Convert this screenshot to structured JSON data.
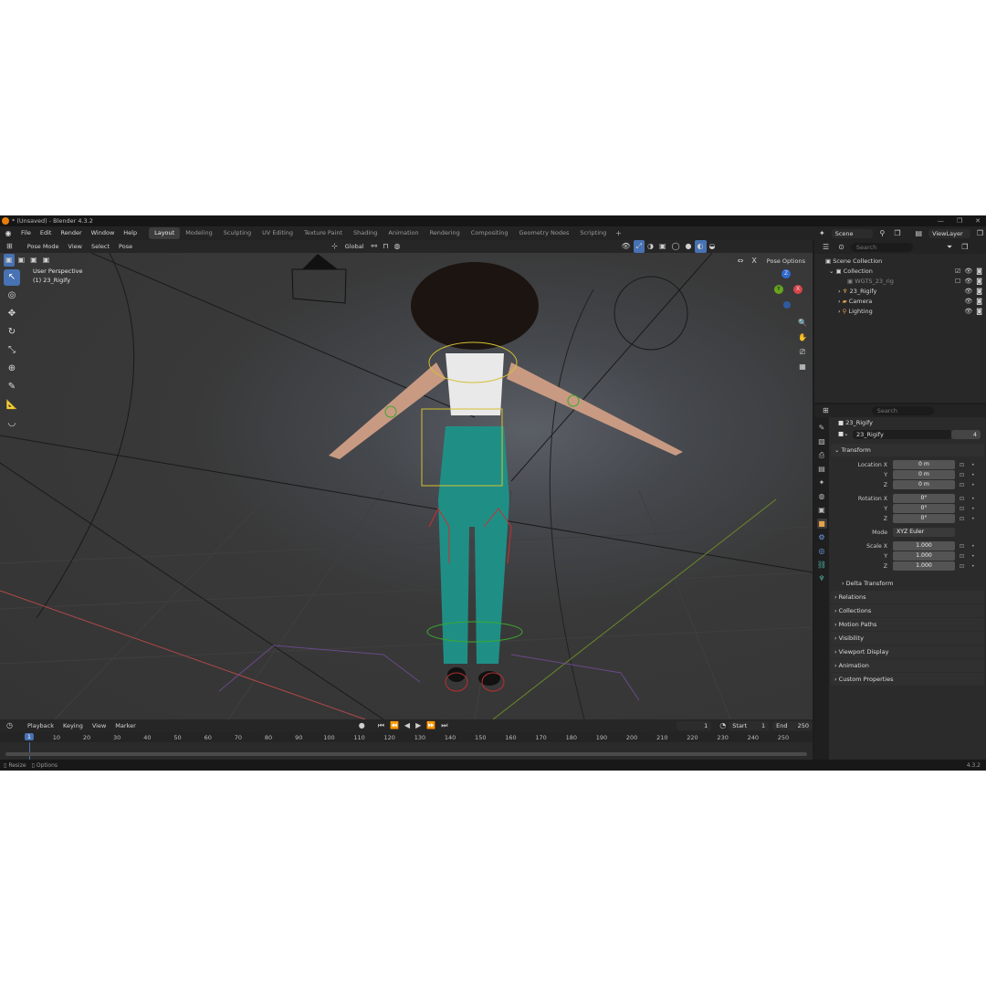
{
  "window": {
    "title": "* (Unsaved) - Blender 4.3.2",
    "controls": [
      "—",
      "❐",
      "✕"
    ]
  },
  "menus": [
    "File",
    "Edit",
    "Render",
    "Window",
    "Help"
  ],
  "workspaces": [
    {
      "label": "Layout",
      "active": true
    },
    {
      "label": "Modeling"
    },
    {
      "label": "Sculpting"
    },
    {
      "label": "UV Editing"
    },
    {
      "label": "Texture Paint"
    },
    {
      "label": "Shading"
    },
    {
      "label": "Animation"
    },
    {
      "label": "Rendering"
    },
    {
      "label": "Compositing"
    },
    {
      "label": "Geometry Nodes"
    },
    {
      "label": "Scripting"
    }
  ],
  "scene": {
    "name": "Scene",
    "view_layer": "ViewLayer"
  },
  "viewport_header": {
    "mode": "Pose Mode",
    "menus": [
      "View",
      "Select",
      "Pose"
    ],
    "orientation": "Global",
    "pose_options": "Pose Options"
  },
  "viewport": {
    "perspective_label": "User Perspective",
    "object_label": "(1) 23_Rigify",
    "axes": {
      "x": "X",
      "y": "Y",
      "z": "Z"
    }
  },
  "timeline": {
    "menus": [
      "Playback",
      "Keying",
      "View",
      "Marker"
    ],
    "current_frame": "1",
    "start_label": "Start",
    "start": "1",
    "end_label": "End",
    "end": "250",
    "ticks": [
      "1",
      "10",
      "20",
      "30",
      "40",
      "50",
      "60",
      "70",
      "80",
      "90",
      "100",
      "110",
      "120",
      "130",
      "140",
      "150",
      "160",
      "170",
      "180",
      "190",
      "200",
      "210",
      "220",
      "230",
      "240",
      "250"
    ]
  },
  "status": {
    "left1": "Resize",
    "left2": "Options",
    "version": "4.3.2"
  },
  "outliner": {
    "search_placeholder": "Search",
    "rows": [
      {
        "label": "Scene Collection",
        "indent": 0
      },
      {
        "label": "Collection",
        "indent": 1
      },
      {
        "label": "WGTS_23_rig",
        "indent": 2,
        "dim": true
      },
      {
        "label": "23_Rigify",
        "indent": 2
      },
      {
        "label": "Camera",
        "indent": 2
      },
      {
        "label": "Lighting",
        "indent": 2
      }
    ]
  },
  "properties": {
    "search_placeholder": "Search",
    "object_name": "23_Rigify",
    "data_name": "23_Rigify",
    "users": "4",
    "transform_label": "Transform",
    "location": {
      "label": "Location X",
      "x": "0 m",
      "y": "0 m",
      "z": "0 m"
    },
    "rotation": {
      "label": "Rotation X",
      "x": "0°",
      "y": "0°",
      "z": "0°"
    },
    "mode_label": "Mode",
    "mode": "XYZ Euler",
    "scale": {
      "label": "Scale X",
      "x": "1.000",
      "y": "1.000",
      "z": "1.000"
    },
    "axis_y": "Y",
    "axis_z": "Z",
    "delta_transform": "Delta Transform",
    "panels": [
      "Relations",
      "Collections",
      "Motion Paths",
      "Visibility",
      "Viewport Display",
      "Animation",
      "Custom Properties"
    ]
  }
}
